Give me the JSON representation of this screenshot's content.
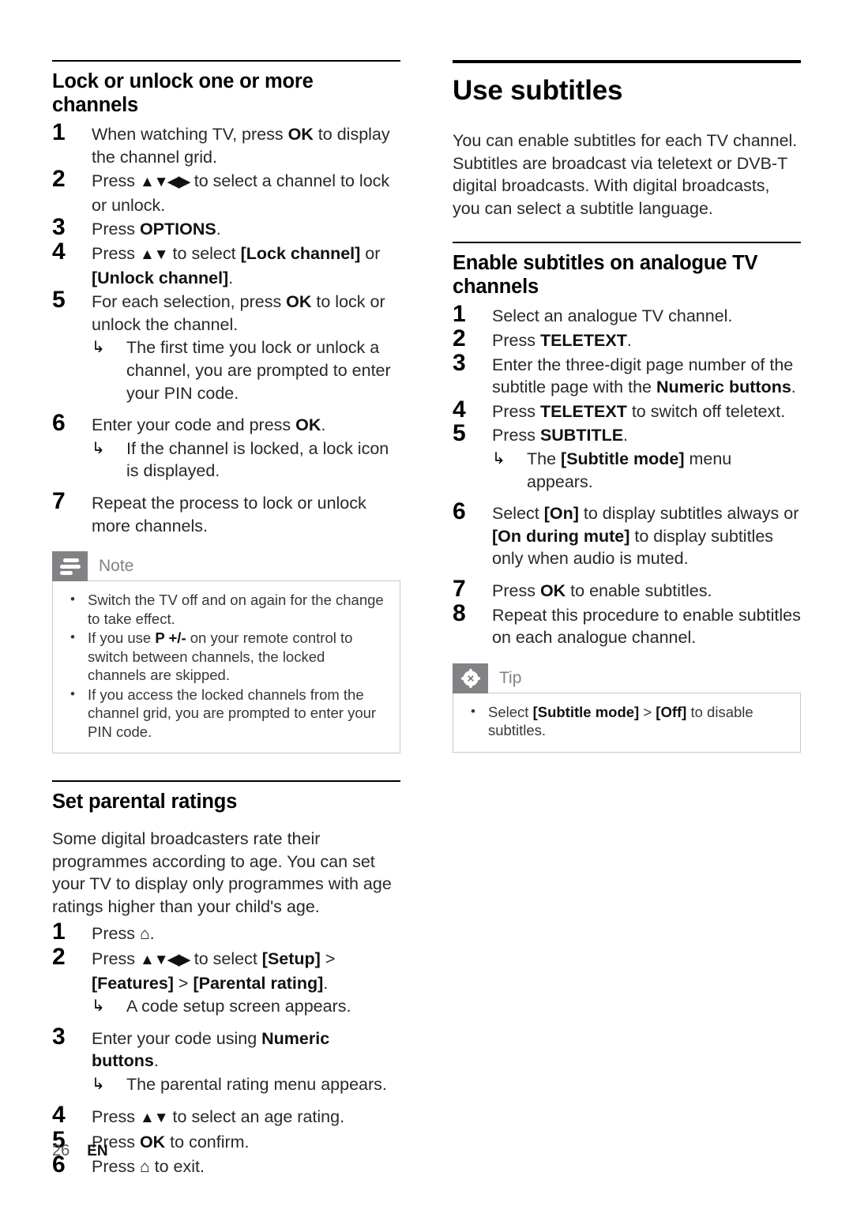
{
  "page": {
    "number": "26",
    "language": "EN"
  },
  "left_column": {
    "section1": {
      "heading": "Lock or unlock one or more channels",
      "steps": [
        {
          "num": "1",
          "html": "When watching TV, press <b>OK</b> to display the channel grid."
        },
        {
          "num": "2",
          "html": "Press <b class=\"arrows\">▲▼◀▶</b> to select a channel to lock or unlock."
        },
        {
          "num": "3",
          "html": "Press <b>OPTIONS</b>."
        },
        {
          "num": "4",
          "html": "Press <b class=\"arrows\">▲▼</b> to select <b>[Lock channel]</b> or <b>[Unlock channel]</b>."
        },
        {
          "num": "5",
          "html": "For each selection, press <b>OK</b> to lock or unlock the channel.",
          "sub": [
            "The first time you lock or unlock a channel, you are prompted to enter your PIN code."
          ]
        },
        {
          "num": "6",
          "html": "Enter your code and press <b>OK</b>.",
          "sub": [
            "If the channel is locked, a lock icon is displayed."
          ]
        },
        {
          "num": "7",
          "html": "Repeat the process to lock or unlock more channels."
        }
      ],
      "note": {
        "label": "Note",
        "icon": "lines-icon",
        "items": [
          "Switch the TV off and on again for the change to take effect.",
          "If you use <b>P +/-</b> on your remote control to switch between channels, the locked channels are skipped.",
          "If you access the locked channels from the channel grid, you are prompted to enter your PIN code."
        ]
      }
    },
    "section2": {
      "heading": "Set parental ratings",
      "intro": "Some digital broadcasters rate their programmes according to age. You can set your TV to display only programmes with age ratings higher than your child's age.",
      "steps": [
        {
          "num": "1",
          "html": "Press <b class=\"home\">⌂</b>."
        },
        {
          "num": "2",
          "html": "Press <b class=\"arrows\">▲▼◀▶</b> to select <b>[Setup]</b> &gt; <b>[Features]</b> &gt; <b>[Parental rating]</b>.",
          "sub": [
            "A code setup screen appears."
          ]
        },
        {
          "num": "3",
          "html": "Enter your code using <b>Numeric buttons</b>.",
          "sub": [
            "The parental rating menu appears."
          ]
        },
        {
          "num": "4",
          "html": "Press <b class=\"arrows\">▲▼</b> to select an age rating."
        },
        {
          "num": "5",
          "html": "Press <b>OK</b> to confirm."
        },
        {
          "num": "6",
          "html": "Press <b class=\"home\">⌂</b> to exit."
        }
      ]
    }
  },
  "right_column": {
    "chapter_title": "Use subtitles",
    "intro": "You can enable subtitles for each TV channel. Subtitles are broadcast via teletext or DVB-T digital broadcasts. With digital broadcasts, you can select a subtitle language.",
    "section": {
      "heading": "Enable subtitles on analogue TV channels",
      "steps": [
        {
          "num": "1",
          "html": "Select an analogue TV channel."
        },
        {
          "num": "2",
          "html": "Press <b>TELETEXT</b>."
        },
        {
          "num": "3",
          "html": "Enter the three-digit page number of the subtitle page with the <b>Numeric buttons</b>."
        },
        {
          "num": "4",
          "html": "Press <b>TELETEXT</b> to switch off teletext."
        },
        {
          "num": "5",
          "html": "Press <b>SUBTITLE</b>.",
          "sub": [
            "The <b>[Subtitle mode]</b> menu appears."
          ]
        },
        {
          "num": "6",
          "html": "Select <b>[On]</b> to display subtitles always or <b>[On during mute]</b> to display subtitles only when audio is muted."
        },
        {
          "num": "7",
          "html": "Press <b>OK</b> to enable subtitles."
        },
        {
          "num": "8",
          "html": "Repeat this procedure to enable subtitles on each analogue channel."
        }
      ],
      "tip": {
        "label": "Tip",
        "icon": "asterisk-icon",
        "items": [
          "Select <b>[Subtitle mode]</b> &gt; <b>[Off]</b> to disable subtitles."
        ]
      }
    }
  },
  "colors": {
    "callout_gray": "#808285",
    "callout_border": "#c7c8ca",
    "text": "#2b2728",
    "rule": "#000000"
  }
}
